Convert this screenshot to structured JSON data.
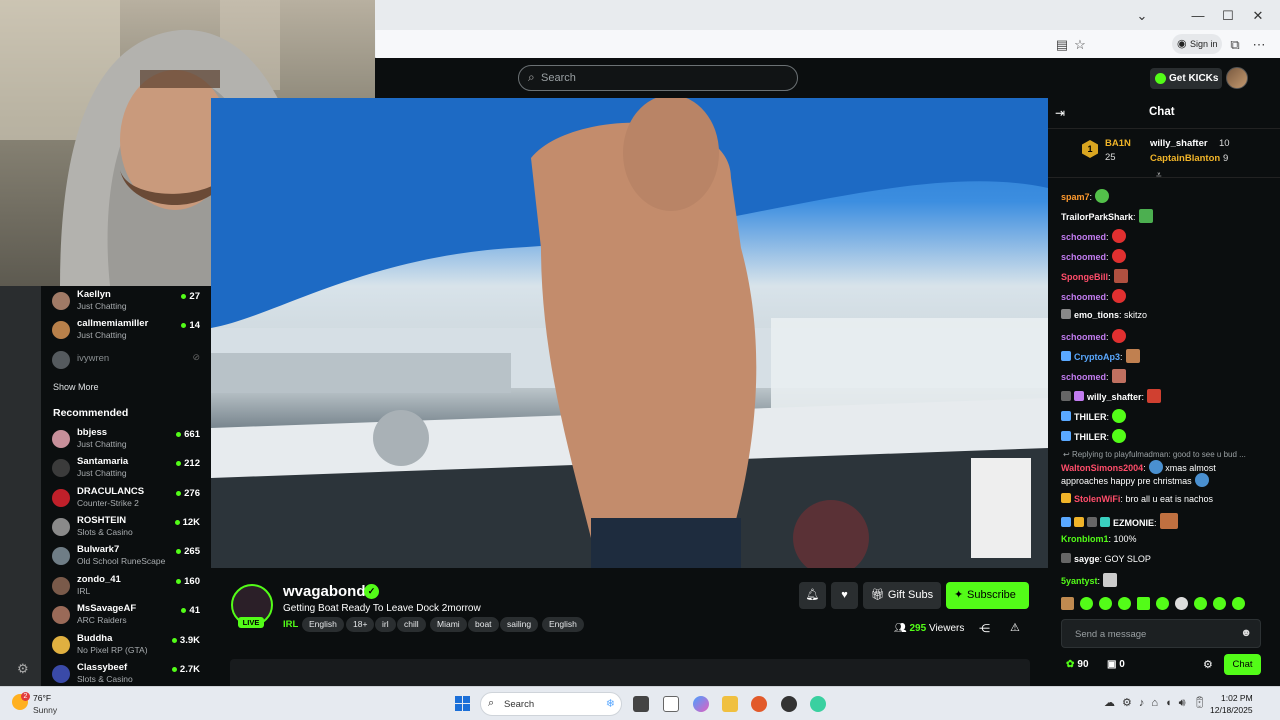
{
  "browser": {
    "sign_in_label": "Sign in"
  },
  "header": {
    "search_placeholder": "Search",
    "get_kicks_label": "Get KICKs"
  },
  "sidebar": {
    "following": [
      {
        "name": "Kaellyn",
        "category": "Just Chatting",
        "viewers": "27",
        "avatar_color": "#a07a66"
      },
      {
        "name": "callmemiamiller",
        "category": "Just Chatting",
        "viewers": "14",
        "avatar_color": "#b8804a"
      },
      {
        "name": "ivywren",
        "category": "",
        "viewers": "",
        "avatar_color": "#555a5e"
      }
    ],
    "show_more_label": "Show More",
    "recommended_heading": "Recommended",
    "recommended": [
      {
        "name": "bbjess",
        "category": "Just Chatting",
        "viewers": "661",
        "avatar_color": "#c78f9a"
      },
      {
        "name": "Santamaria",
        "category": "Just Chatting",
        "viewers": "212",
        "avatar_color": "#3b3b3b"
      },
      {
        "name": "DRACULANCS",
        "category": "Counter-Strike 2",
        "viewers": "276",
        "avatar_color": "#c0202a"
      },
      {
        "name": "ROSHTEIN",
        "category": "Slots & Casino",
        "viewers": "12K",
        "avatar_color": "#8a8a8a"
      },
      {
        "name": "Bulwark7",
        "category": "Old School RuneScape",
        "viewers": "265",
        "avatar_color": "#6f7d86"
      },
      {
        "name": "zondo_41",
        "category": "IRL",
        "viewers": "160",
        "avatar_color": "#7a5a4a"
      },
      {
        "name": "MsSavageAF",
        "category": "ARC Raiders",
        "viewers": "41",
        "avatar_color": "#9a6a58"
      },
      {
        "name": "Buddha",
        "category": "No Pixel RP (GTA)",
        "viewers": "3.9K",
        "avatar_color": "#e0b040"
      },
      {
        "name": "Classybeef",
        "category": "Slots & Casino",
        "viewers": "2.7K",
        "avatar_color": "#3a4aa8"
      }
    ]
  },
  "stream": {
    "channel_name": "wvagabond",
    "verified_icon": "check-icon",
    "live_label": "LIVE",
    "title": "Getting Boat Ready To Leave Dock 2morrow",
    "category": "IRL",
    "tags": [
      "English",
      "18+",
      "irl",
      "chill",
      "Miami",
      "boat",
      "sailing",
      "English"
    ],
    "gift_subs_label": "Gift Subs",
    "subscribe_label": "Subscribe",
    "viewer_count": "295",
    "viewers_label": "Viewers"
  },
  "chat": {
    "title": "Chat",
    "leaderboard": {
      "rank": "1",
      "first_name": "BA1N",
      "first_count": "25",
      "second_name": "willy_shafter",
      "second_count": "10",
      "third_name": "CaptainBlanton",
      "third_count": "9"
    },
    "messages": [
      {
        "user": "spam7",
        "color": "#ff9a2e",
        "text": "",
        "emote": "#53c04a"
      },
      {
        "user": "TrailorParkShark",
        "color": "#ffffff",
        "text": "",
        "emote": "#4caf50"
      },
      {
        "user": "schoomed",
        "color": "#c27cf0",
        "text": "",
        "emote": "#e03030"
      },
      {
        "user": "schoomed",
        "color": "#c27cf0",
        "text": "",
        "emote": "#e03030"
      },
      {
        "user": "SpongeBill",
        "color": "#ff4d6a",
        "text": "",
        "emote": "#b05040"
      },
      {
        "user": "schoomed",
        "color": "#c27cf0",
        "text": "",
        "emote": "#e03030"
      },
      {
        "user": "emo_tions",
        "color": "#ffffff",
        "text": "skitzo",
        "emote": ""
      },
      {
        "user": "schoomed",
        "color": "#c27cf0",
        "text": "",
        "emote": "#e03030"
      },
      {
        "user": "CryptoAp3",
        "color": "#5aa8ff",
        "text": "",
        "emote": "#c08050"
      },
      {
        "user": "schoomed",
        "color": "#c27cf0",
        "text": "",
        "emote": "#c07060"
      },
      {
        "user": "willy_shafter",
        "color": "#ffffff",
        "text": "",
        "emote": "#d04030"
      },
      {
        "user": "THILER",
        "color": "#ffffff",
        "text": "",
        "emote": "#53fc18"
      },
      {
        "user": "THILER",
        "color": "#ffffff",
        "text": "",
        "emote": "#53fc18"
      }
    ],
    "reply_context": "Replying to playfulmadman: good to see u bud ...",
    "reply_message": {
      "user": "WaltonSimons2004",
      "color": "#ff4d6a",
      "text_1": "xmas almost",
      "text_2": "approaches happy pre christmas"
    },
    "messages_after": [
      {
        "user": "StolenWiFi",
        "color": "#ff4d6a",
        "text": "bro all u eat is nachos"
      },
      {
        "user": "EZMONIE",
        "color": "#ffffff",
        "text": ""
      },
      {
        "user": "Kronblom1",
        "color": "#53fc18",
        "text": "100%"
      },
      {
        "user": "sayge",
        "color": "#ffffff",
        "text": "GOY SLOP"
      },
      {
        "user": "5yantyst",
        "color": "#53fc18",
        "text": ""
      }
    ],
    "input_placeholder": "Send a message",
    "kicks_count": "90",
    "gifts_count": "0",
    "send_label": "Chat"
  },
  "taskbar": {
    "weather_temp": "76°F",
    "weather_desc": "Sunny",
    "weather_badge": "2",
    "search_placeholder": "Search",
    "time": "1:02 PM",
    "date": "12/18/2025"
  }
}
